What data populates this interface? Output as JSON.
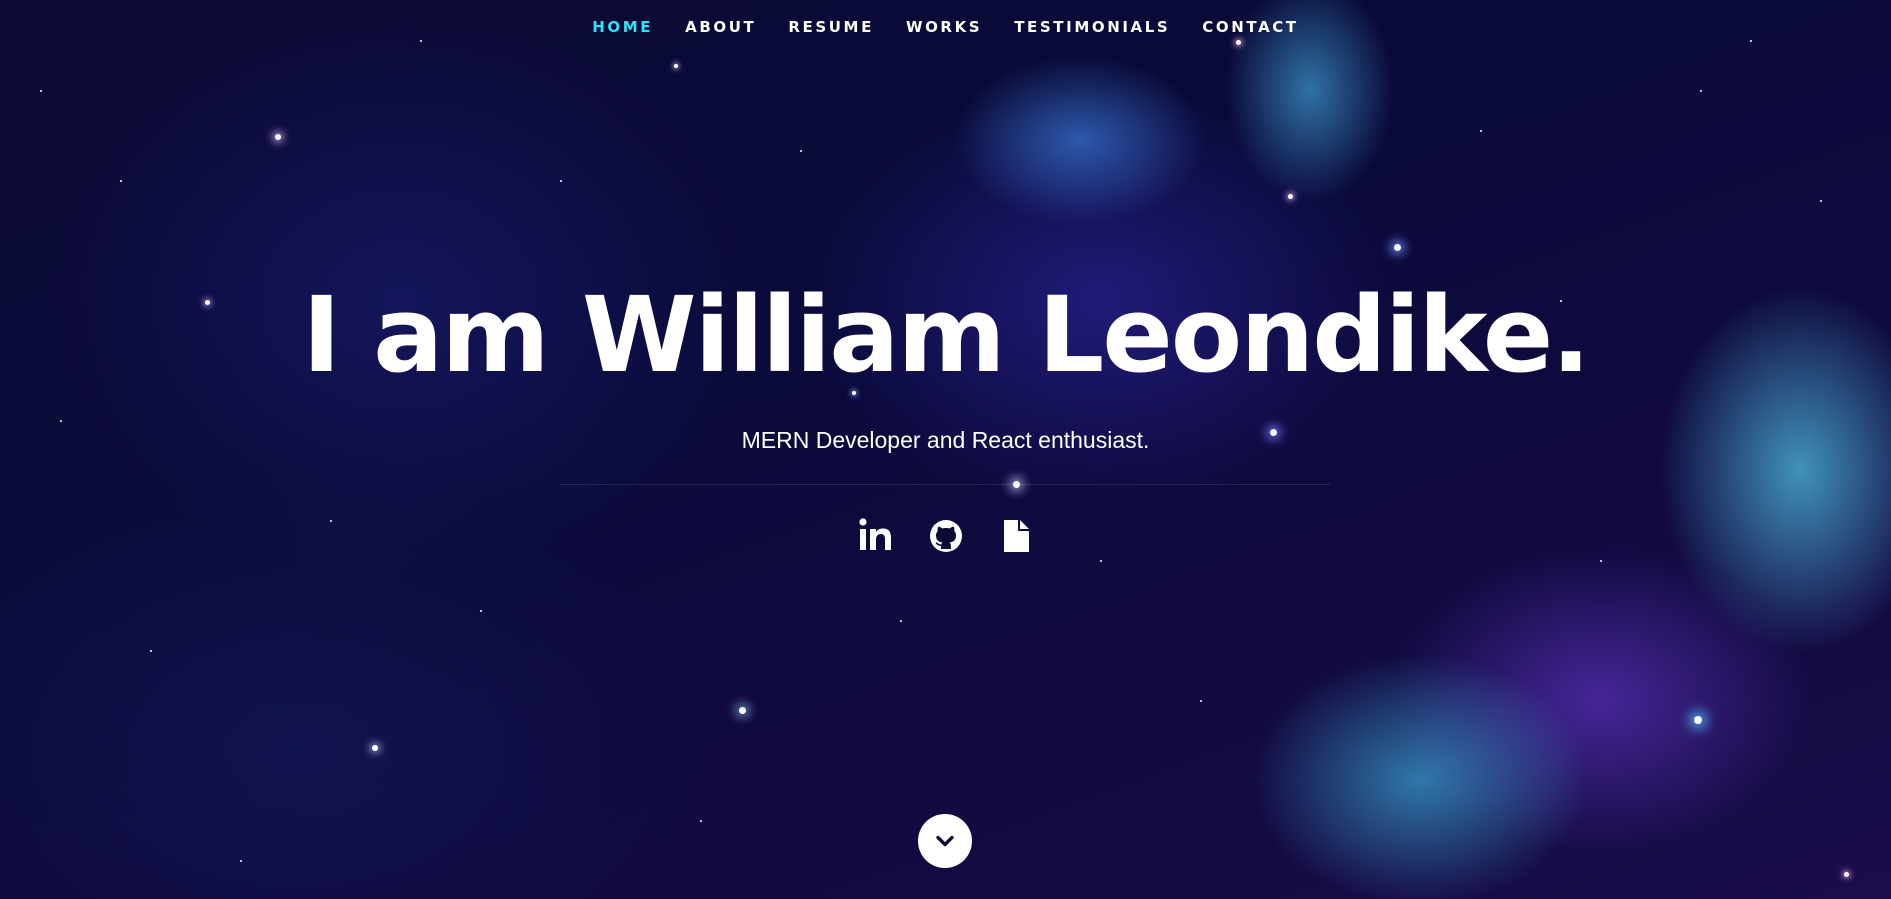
{
  "nav": {
    "items": [
      {
        "label": "HOME",
        "active": true
      },
      {
        "label": "ABOUT",
        "active": false
      },
      {
        "label": "RESUME",
        "active": false
      },
      {
        "label": "WORKS",
        "active": false
      },
      {
        "label": "TESTIMONIALS",
        "active": false
      },
      {
        "label": "CONTACT",
        "active": false
      }
    ]
  },
  "hero": {
    "title": "I am William Leondike.",
    "subtitle": "MERN Developer and React enthusiast."
  },
  "social": [
    {
      "icon": "linkedin-icon"
    },
    {
      "icon": "github-icon"
    },
    {
      "icon": "document-icon"
    }
  ],
  "scroll": {
    "icon": "chevron-down-icon"
  },
  "colors": {
    "accent": "#2ee3f5",
    "text": "#ffffff",
    "background": "#0b0a35"
  }
}
